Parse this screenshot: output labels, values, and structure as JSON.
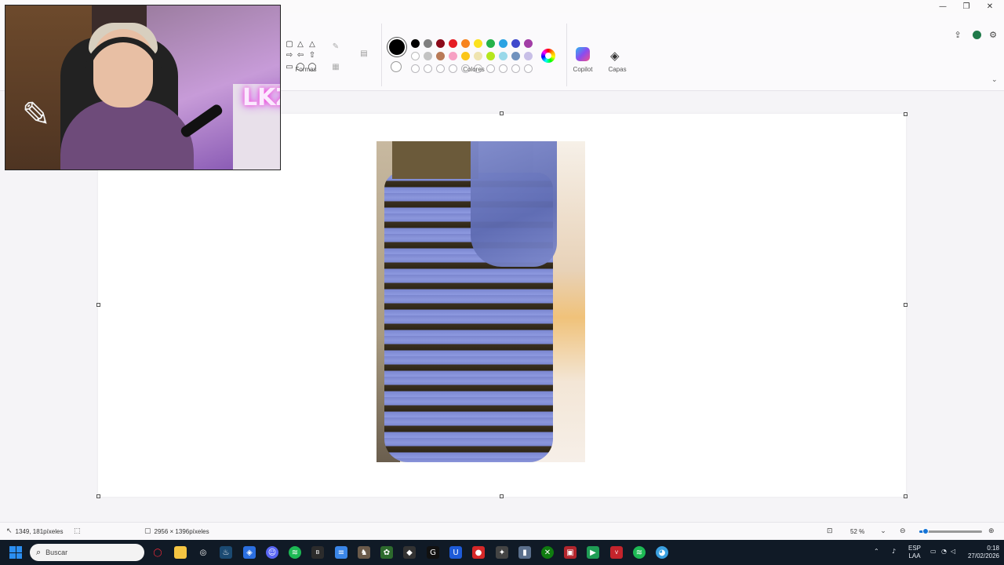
{
  "app": {
    "window_controls": [
      "—",
      "❐",
      "✕"
    ]
  },
  "ribbon": {
    "groups": {
      "shapes": "Formas",
      "colors": "Colores",
      "copilot": "Copilot",
      "layers": "Capas"
    },
    "palette_row1": [
      "#000000",
      "#7f7f7f",
      "#8b0a1a",
      "#e51d24",
      "#f7831e",
      "#fbe21f",
      "#24b24a",
      "#2aa3e3",
      "#3f48cc",
      "#a23ea6"
    ],
    "palette_row2": [
      "#ffffff",
      "#c3c3c3",
      "#b97a57",
      "#f7a1c4",
      "#fbc61a",
      "#efe4b0",
      "#b5e61d",
      "#99d9ea",
      "#7092be",
      "#c8bfe7"
    ],
    "current_color": "#000000"
  },
  "canvas": {
    "image_subject": "vestido"
  },
  "statusbar": {
    "cursor_position": "1349, 181píxeles",
    "image_size": "2956 × 1396píxeles",
    "zoom": "52 %",
    "zoom_level": 0.1
  },
  "taskbar": {
    "search_placeholder": "Buscar",
    "language": "ESP",
    "language_sub": "LAA",
    "time": "0:18",
    "date": "27/02/2026"
  },
  "webcam": {
    "neon_text": "LKZ"
  }
}
